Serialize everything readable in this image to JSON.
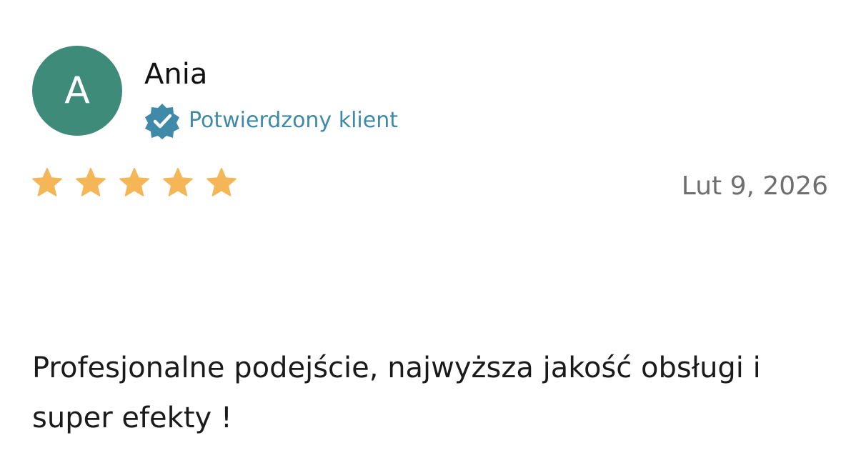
{
  "review": {
    "avatar_initial": "A",
    "author_name": "Ania",
    "verified_label": "Potwierdzony klient",
    "verified_icon": "verified-check-badge-icon",
    "rating": 5,
    "rating_max": 5,
    "star_icon": "star-icon",
    "date": "Lut 9, 2026",
    "text": "Profesjonalne podejście, najwyższa jakość obsługi i super efekty !"
  },
  "colors": {
    "avatar_bg": "#3d8b78",
    "verified_badge": "#3f8aa8",
    "verified_text": "#3f8aa8",
    "star": "#f5b658"
  }
}
